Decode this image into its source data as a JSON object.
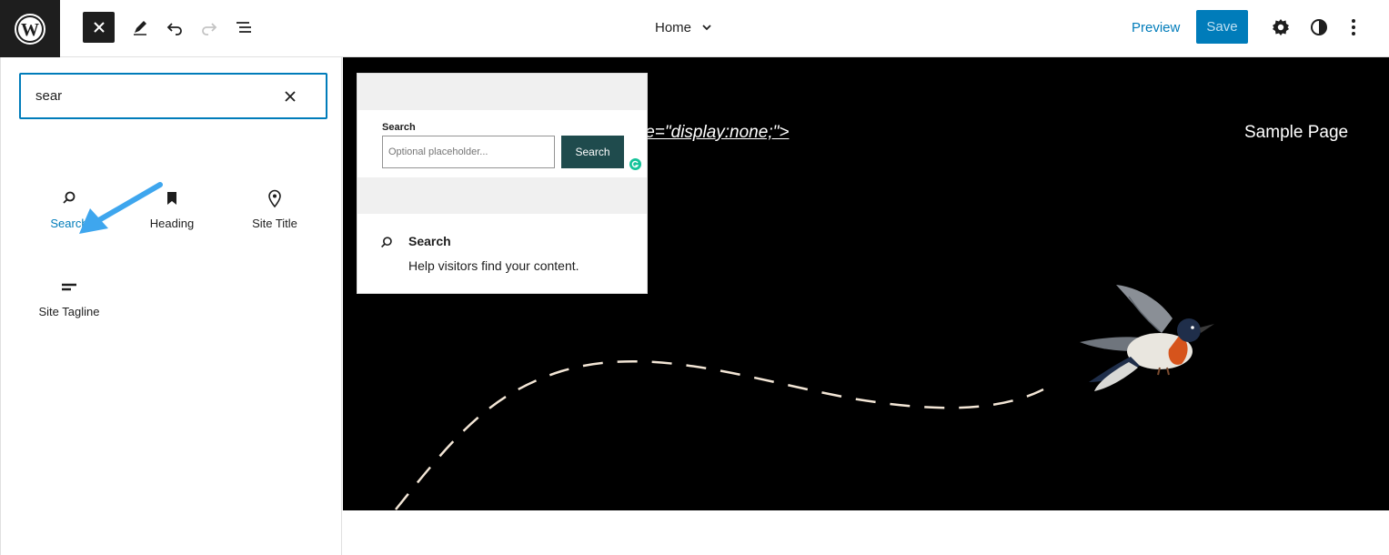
{
  "toolbar": {
    "document_title": "Home",
    "preview_label": "Preview",
    "save_label": "Save"
  },
  "inserter": {
    "search_value": "sear",
    "blocks": [
      {
        "label": "Search",
        "icon": "search-icon",
        "active": true
      },
      {
        "label": "Heading",
        "icon": "bookmark-icon",
        "active": false
      },
      {
        "label": "Site Title",
        "icon": "map-pin-icon",
        "active": false
      },
      {
        "label": "Site Tagline",
        "icon": "tagline-icon",
        "active": false
      }
    ]
  },
  "canvas": {
    "code_text": "le=\"display:none;\">",
    "nav_link": "Sample Page"
  },
  "block_preview": {
    "form_label": "Search",
    "placeholder": "Optional placeholder...",
    "button_label": "Search",
    "card_title": "Search",
    "card_description": "Help visitors find your content."
  },
  "colors": {
    "accent": "#007cba",
    "dark": "#1e1e1e",
    "canvas_bg": "#000000",
    "search_button_bg": "#1f4b4d",
    "annotation_arrow": "#3ea6ee"
  }
}
